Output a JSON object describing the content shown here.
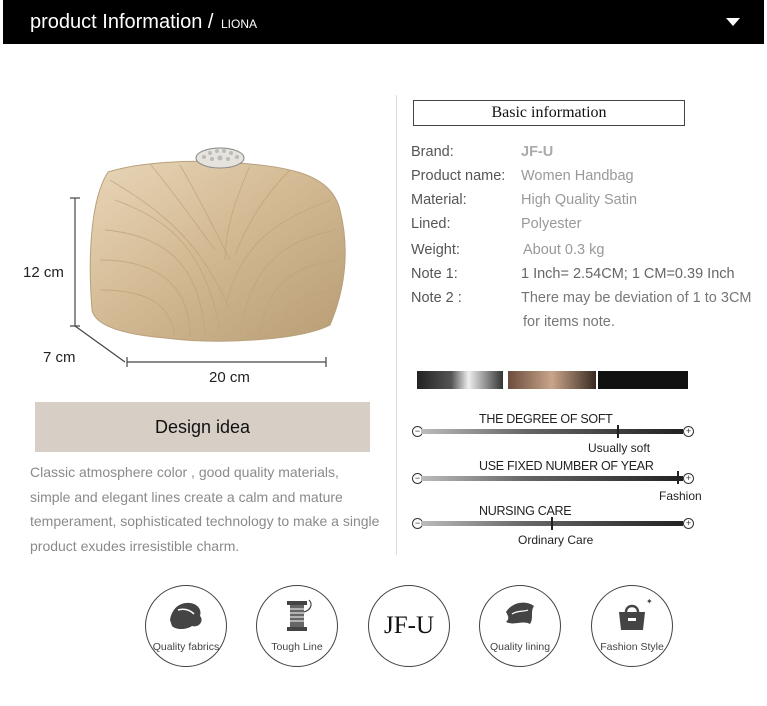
{
  "header": {
    "title": "product Information /",
    "subtitle": "LIONA"
  },
  "product_image": {
    "height_label": "12 cm",
    "depth_label": "7 cm",
    "width_label": "20 cm"
  },
  "basic_info": {
    "heading": "Basic information",
    "rows": [
      {
        "label": "Brand:",
        "value": "JF-U"
      },
      {
        "label": "Product name:",
        "value": "Women Handbag"
      },
      {
        "label": "Material:",
        "value": "High Quality Satin"
      },
      {
        "label": "Lined:",
        "value": "Polyester"
      },
      {
        "label": "Weight:",
        "value": "About  0.3  kg"
      },
      {
        "label": "Note 1:",
        "value": "1 Inch= 2.54CM; 1 CM=0.39 Inch"
      },
      {
        "label": "Note 2 :",
        "value": "There may be deviation of 1 to 3CM",
        "value2": "for items note."
      }
    ]
  },
  "scales": [
    {
      "title": "THE DEGREE OF SOFT",
      "label": "Usually soft",
      "level": 0.75
    },
    {
      "title": "USE FIXED NUMBER OF YEAR",
      "label": "Fashion",
      "level": 0.98
    },
    {
      "title": "NURSING CARE",
      "label": "Ordinary Care",
      "level": 0.5
    }
  ],
  "design": {
    "heading": "Design idea",
    "text": "Classic atmosphere color , good quality materials, simple and elegant lines create a calm and mature temperament, sophisticated technology to make a single product exudes irresistible charm."
  },
  "features": [
    {
      "label": "Quality fabrics",
      "icon": "fabric-icon"
    },
    {
      "label": "Tough Line",
      "icon": "thread-spool-icon"
    },
    {
      "label": "JF-U",
      "icon": "brand-logo"
    },
    {
      "label": "Quality lining",
      "icon": "lining-icon"
    },
    {
      "label": "Fashion Style",
      "icon": "handbag-icon"
    }
  ],
  "colors": {
    "header_bg": "#000000",
    "design_bg": "#d7cfc6",
    "bag": "#d9c3a0"
  }
}
